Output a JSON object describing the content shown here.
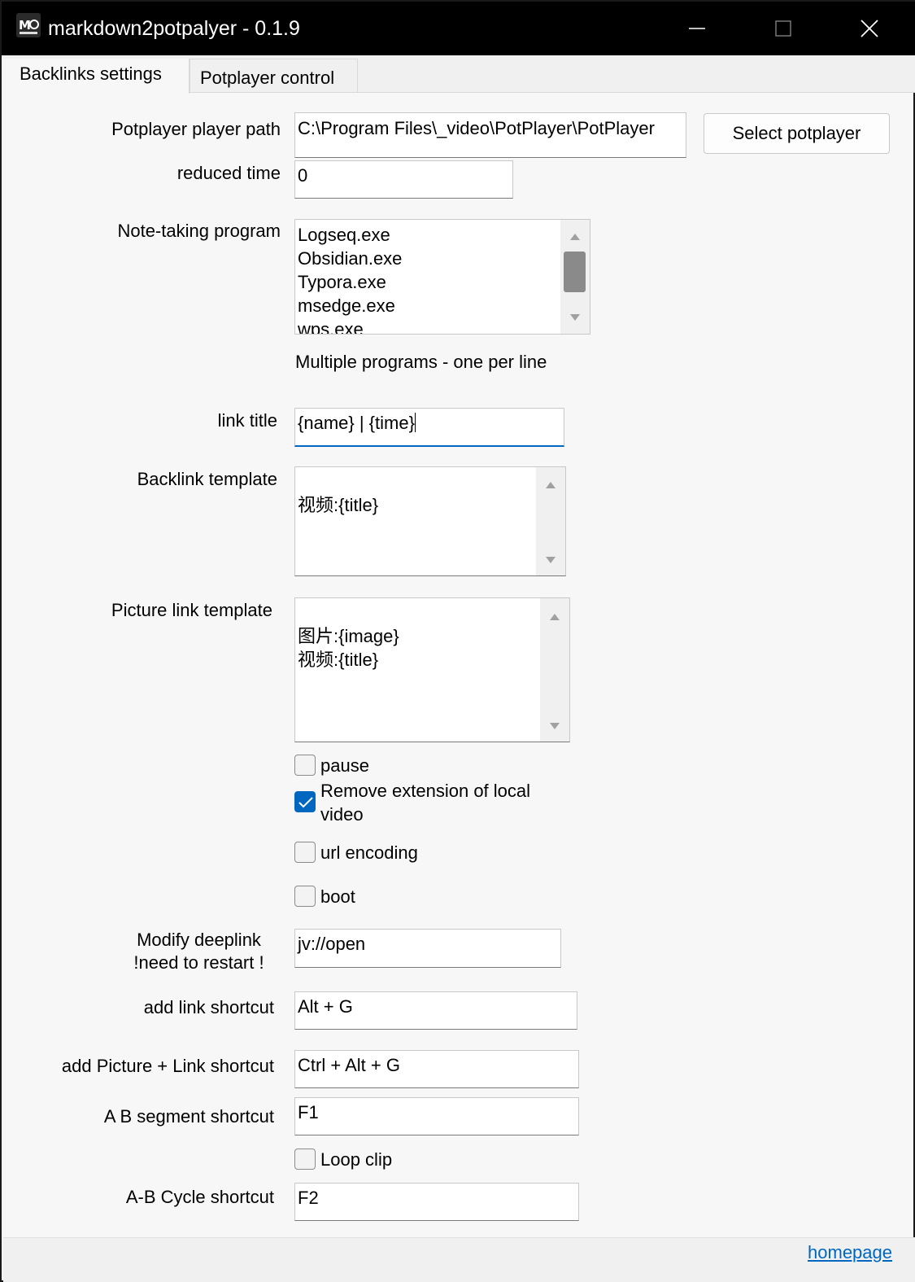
{
  "window": {
    "title": "markdown2potpalyer - 0.1.9",
    "app_icon_text": "M"
  },
  "tabs": [
    {
      "label": "Backlinks settings",
      "selected": true
    },
    {
      "label": "Potplayer control",
      "selected": false
    }
  ],
  "form": {
    "potplayer_path": {
      "label": "Potplayer player path",
      "value": "C:\\Program Files\\_video\\PotPlayer\\PotPlayer"
    },
    "select_button": "Select potplayer",
    "reduced_time": {
      "label": "reduced time",
      "value": "0"
    },
    "note_programs": {
      "label": "Note-taking program",
      "items": [
        "Logseq.exe",
        "Obsidian.exe",
        "Typora.exe",
        "msedge.exe",
        "wps.exe"
      ],
      "hint": "Multiple programs - one per line"
    },
    "link_title": {
      "label": "link title",
      "value": "{name} | {time}"
    },
    "backlink_template": {
      "label": "Backlink template",
      "lines": [
        "视频:{title}"
      ]
    },
    "picture_link_template": {
      "label": "Picture link template",
      "lines": [
        "图片:{image}",
        "视频:{title}"
      ]
    },
    "checkboxes": [
      {
        "label": "pause",
        "checked": false
      },
      {
        "label": "Remove extension of local video",
        "checked": true
      },
      {
        "label": "url encoding",
        "checked": false
      },
      {
        "label": "boot",
        "checked": false
      }
    ],
    "deeplink": {
      "label_line1": "Modify deeplink",
      "label_line2": "!need to restart !",
      "value": "jv://open"
    },
    "add_link_shortcut": {
      "label": "add link shortcut",
      "value": "Alt + G"
    },
    "add_picture_link_shortcut": {
      "label": "add Picture + Link shortcut",
      "value": "Ctrl + Alt + G"
    },
    "ab_segment_shortcut": {
      "label": "A B segment shortcut",
      "value": "F1"
    },
    "loop_clip": {
      "label": "Loop clip",
      "checked": false
    },
    "ab_cycle_shortcut": {
      "label": "A-B Cycle shortcut",
      "value": "F2"
    }
  },
  "footer": {
    "homepage_link": "homepage"
  },
  "colors": {
    "accent": "#0067c0",
    "titlebar": "#000000",
    "background": "#f7f7f7"
  }
}
